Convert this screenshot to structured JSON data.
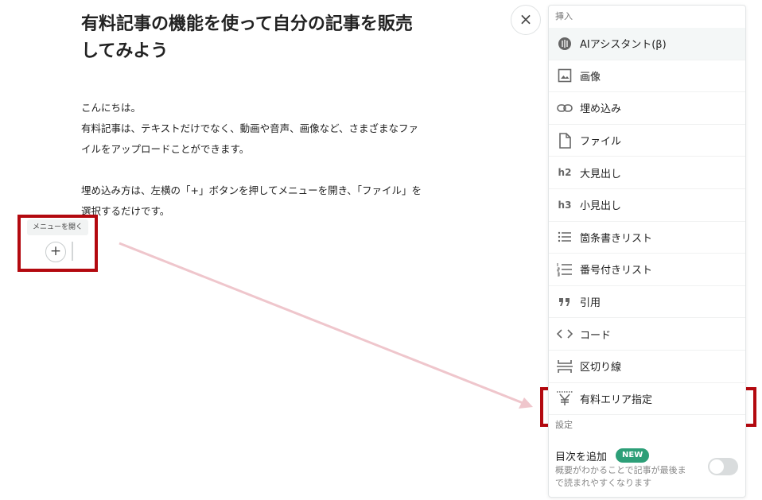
{
  "article": {
    "title_line1": "有料記事の機能を使って自分の記事を販売",
    "title_line2": "してみよう",
    "para1": [
      "こんにちは。",
      "有料記事は、テキストだけでなく、動画や音声、画像など、さまざまなファ",
      "イルをアップロードことができます。"
    ],
    "para2": [
      "埋め込み方は、左横の「+」ボタンを押してメニューを開き、「ファイル」を",
      "選択するだけです。"
    ]
  },
  "editor": {
    "tooltip": "メニューを開く",
    "plus_label": "+"
  },
  "close_label": "×",
  "panel": {
    "insert_label": "挿入",
    "items": [
      {
        "label": "AIアシスタント(β)",
        "icon": "ai-assistant-icon"
      },
      {
        "label": "画像",
        "icon": "image-icon"
      },
      {
        "label": "埋め込み",
        "icon": "link-icon"
      },
      {
        "label": "ファイル",
        "icon": "file-icon"
      },
      {
        "label": "大見出し",
        "icon": "h2-icon",
        "glyph": "h2"
      },
      {
        "label": "小見出し",
        "icon": "h3-icon",
        "glyph": "h3"
      },
      {
        "label": "箇条書きリスト",
        "icon": "bullet-list-icon"
      },
      {
        "label": "番号付きリスト",
        "icon": "numbered-list-icon"
      },
      {
        "label": "引用",
        "icon": "quote-icon"
      },
      {
        "label": "コード",
        "icon": "code-icon"
      },
      {
        "label": "区切り線",
        "icon": "divider-icon"
      },
      {
        "label": "有料エリア指定",
        "icon": "paid-area-icon"
      }
    ],
    "settings_label": "設定",
    "toc": {
      "title": "目次を追加",
      "badge": "NEW",
      "desc_line1": "概要がわかることで記事が最後ま",
      "desc_line2": "で読まれやすくなります",
      "enabled": false
    }
  },
  "colors": {
    "highlight_red": "#b3090f",
    "badge_green": "#2d9f78",
    "arrow_pink": "#efc6cc"
  }
}
